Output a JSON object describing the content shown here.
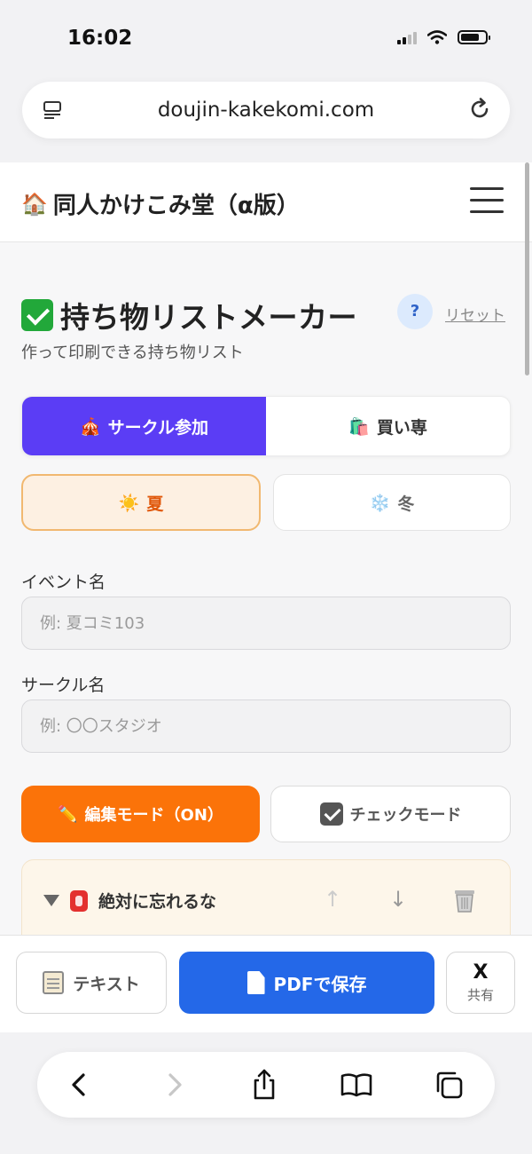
{
  "status_bar": {
    "time": "16:02"
  },
  "browser": {
    "url": "doujin-kakekomi.com"
  },
  "site": {
    "title": "同人かけこみ堂（α版）",
    "house_emoji": "🏠"
  },
  "page": {
    "title": "持ち物リストメーカー",
    "help_label": "?",
    "reset_label": "リセット",
    "subtitle": "作って印刷できる持ち物リスト"
  },
  "participation_tabs": [
    {
      "emoji": "🎪",
      "label": "サークル参加",
      "active": true
    },
    {
      "emoji": "🛍️",
      "label": "買い専",
      "active": false
    }
  ],
  "season_tabs": [
    {
      "emoji": "☀️",
      "label": "夏",
      "active": true
    },
    {
      "emoji": "❄️",
      "label": "冬",
      "active": false
    }
  ],
  "form": {
    "event": {
      "label": "イベント名",
      "placeholder": "例: 夏コミ103",
      "value": ""
    },
    "circle": {
      "label": "サークル名",
      "placeholder": "例: 〇〇スタジオ",
      "value": ""
    }
  },
  "modes": {
    "edit": {
      "emoji": "✏️",
      "label": "編集モード（ON）"
    },
    "check": {
      "label": "チェックモード"
    }
  },
  "section": {
    "title": "絶対に忘れるな",
    "up_arrow": "↑",
    "down_arrow": "↓"
  },
  "actions": {
    "text_label": "テキスト",
    "pdf_label": "PDFで保存",
    "share_logo": "X",
    "share_label": "共有"
  },
  "colors": {
    "primary_purple": "#5b3df5",
    "summer_orange": "#e0570a",
    "edit_orange": "#fb7309",
    "pdf_blue": "#2468e8"
  }
}
